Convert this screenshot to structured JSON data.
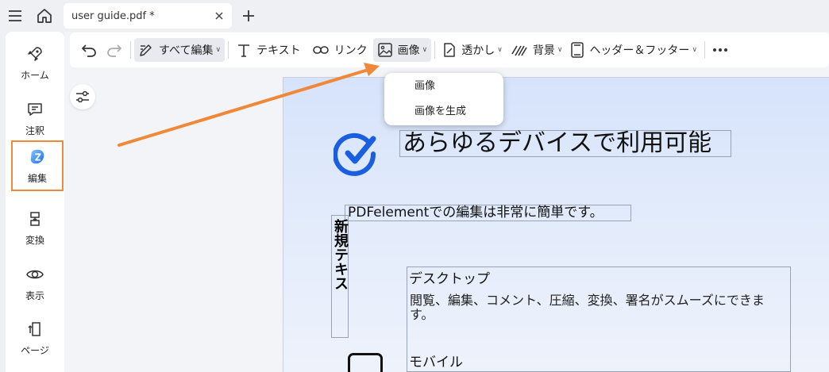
{
  "titlebar": {
    "tab_title": "user guide.pdf *",
    "icons": [
      "menu-icon",
      "home-icon",
      "close-icon",
      "plus-icon"
    ]
  },
  "rail": {
    "items": [
      {
        "label": "ホーム",
        "icon": "rocket-icon"
      },
      {
        "label": "注釈",
        "icon": "comment-icon"
      },
      {
        "label": "編集",
        "icon": "edit-logo-icon",
        "active": true
      },
      {
        "label": "変換",
        "icon": "convert-icon"
      },
      {
        "label": "表示",
        "icon": "eye-icon"
      },
      {
        "label": "ページ",
        "icon": "pages-icon"
      }
    ]
  },
  "toolbar": {
    "edit_all": "すべて編集",
    "text": "テキスト",
    "link": "リンク",
    "image": "画像",
    "watermark": "透かし",
    "background": "背景",
    "header_footer": "ヘッダー＆フッター"
  },
  "dropdown": {
    "items": [
      "画像",
      "画像を生成"
    ]
  },
  "page": {
    "heading": "あらゆるデバイスで利用可能",
    "subheading": "PDFelementでの編集は非常に簡単です。",
    "vertical_text": "新規テキス",
    "desktop_title": "デスクトップ",
    "desktop_body": "閲覧、編集、コメント、圧縮、変換、署名がスムーズにできます。",
    "mobile_title": "モバイル"
  },
  "colors": {
    "accent_orange": "#f0883a",
    "check_blue": "#1a5fe0"
  }
}
